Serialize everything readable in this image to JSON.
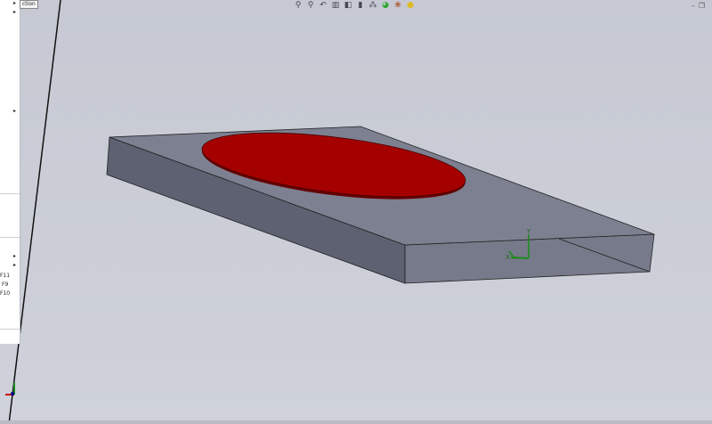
{
  "panel": {
    "tooltip": "ction",
    "shortcuts": [
      "F11",
      "F9",
      "F10"
    ]
  },
  "toolbar": {
    "icons": [
      "zoom-to-fit-icon",
      "zoom-area-icon",
      "previous-view-icon",
      "section-view-icon",
      "view-orientation-icon",
      "display-style-icon",
      "hide-show-icon",
      "edit-appearance-icon",
      "apply-scene-icon",
      "view-settings-icon"
    ],
    "glyphs": [
      "⚲",
      "⚲",
      "↶",
      "▥",
      "◧",
      "▮",
      "⁂",
      "◕",
      "❀",
      "●"
    ]
  },
  "window": {
    "minimize": "–",
    "restore": "❐"
  },
  "triad": {
    "x": "X",
    "y": "Y"
  },
  "colors": {
    "plate_top": "#7b7f8e",
    "plate_side": "#5c6070",
    "plate_front": "#6b6f7f",
    "disc": "#a80000",
    "viewport": "#c9ccd6"
  }
}
